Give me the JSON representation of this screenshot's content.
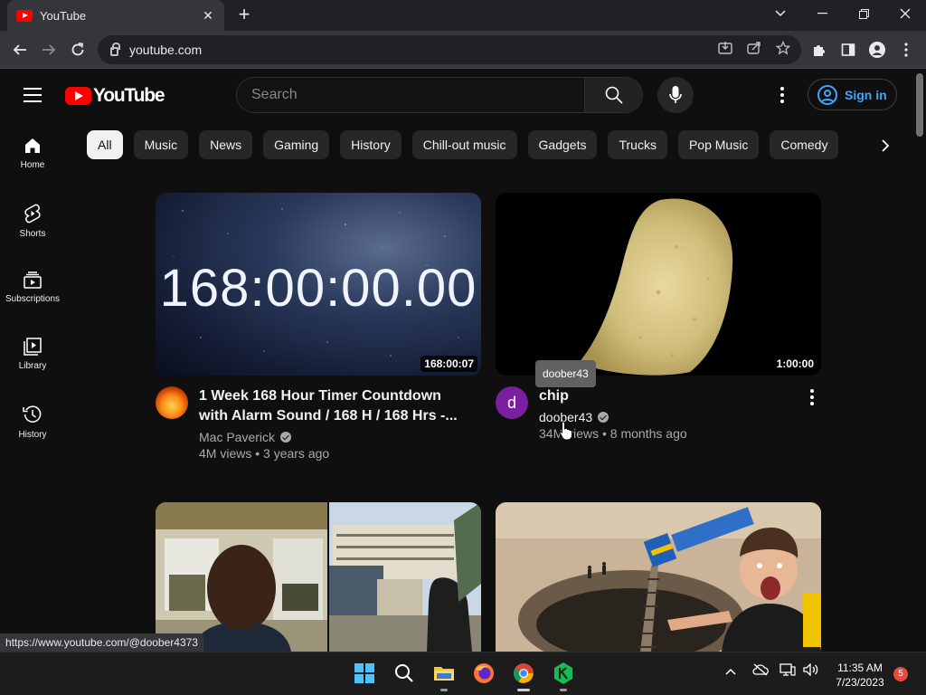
{
  "browser": {
    "tab_title": "YouTube",
    "tab_close": "✕",
    "new_tab": "+",
    "url": "youtube.com",
    "status_link": "https://www.youtube.com/@doober4373"
  },
  "masthead": {
    "logo_text": "YouTube",
    "search_placeholder": "Search",
    "sign_in": "Sign in"
  },
  "sidebar": {
    "items": [
      {
        "label": "Home",
        "icon": "home-icon"
      },
      {
        "label": "Shorts",
        "icon": "shorts-icon"
      },
      {
        "label": "Subscriptions",
        "icon": "subscriptions-icon"
      },
      {
        "label": "Library",
        "icon": "library-icon"
      },
      {
        "label": "History",
        "icon": "history-icon"
      }
    ]
  },
  "chips": [
    "All",
    "Music",
    "News",
    "Gaming",
    "History",
    "Chill-out music",
    "Gadgets",
    "Trucks",
    "Pop Music",
    "Comedy"
  ],
  "videos": [
    {
      "title": "1 Week 168 Hour Timer Countdown with Alarm Sound / 168 H / 168 Hrs -...",
      "channel": "Mac Paverick",
      "stats": "4M views • 3 years ago",
      "duration": "168:00:07",
      "thumb_text": "168:00:00.00"
    },
    {
      "title": "chip",
      "channel": "doober43",
      "stats": "34M views • 8 months ago",
      "duration": "1:00:00",
      "avatar_letter": "d"
    }
  ],
  "tooltip": "doober43",
  "taskbar": {
    "time": "11:35 AM",
    "date": "7/23/2023",
    "notifications": "5"
  },
  "colors": {
    "background": "#0f0f0f",
    "chip_bg": "#272727",
    "brand_red": "#ff0000",
    "link_blue": "#3ea6ff",
    "avatar_purple": "#7b1fa2"
  }
}
